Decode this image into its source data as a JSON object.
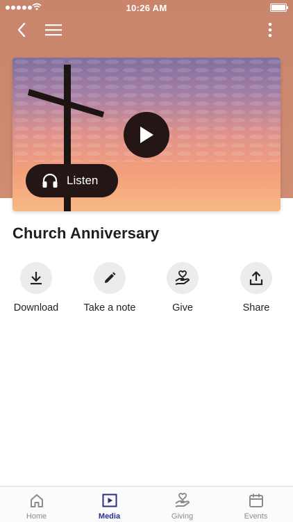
{
  "status_bar": {
    "time": "10:26 AM"
  },
  "header": {
    "back_icon": "chevron-left-icon",
    "menu_icon": "hamburger-icon",
    "more_icon": "more-vertical-icon",
    "background_color": "#cc8a70"
  },
  "hero": {
    "play_icon": "play-icon",
    "listen_label": "Listen",
    "listen_icon": "headphones-icon"
  },
  "media_title": "Church Anniversary",
  "actions": [
    {
      "label": "Download",
      "icon": "download-icon"
    },
    {
      "label": "Take a note",
      "icon": "pencil-icon"
    },
    {
      "label": "Give",
      "icon": "giving-hand-heart-icon"
    },
    {
      "label": "Share",
      "icon": "share-icon"
    }
  ],
  "tabs": [
    {
      "label": "Home",
      "icon": "home-icon",
      "active": false
    },
    {
      "label": "Media",
      "icon": "media-play-icon",
      "active": true
    },
    {
      "label": "Giving",
      "icon": "giving-hand-heart-icon",
      "active": false
    },
    {
      "label": "Events",
      "icon": "calendar-icon",
      "active": false
    }
  ],
  "colors": {
    "accent": "#2a2e8c",
    "button_dark": "#241614",
    "action_circle": "#ececec"
  }
}
